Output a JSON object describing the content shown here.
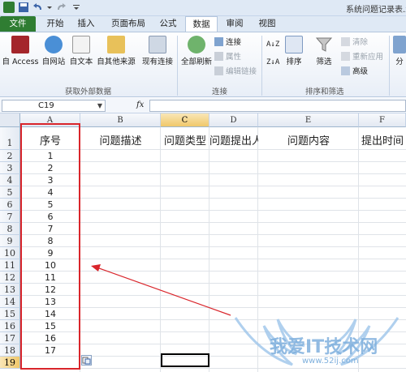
{
  "window": {
    "title": "系统问题记录表.x"
  },
  "ribbon_tabs": [
    "文件",
    "开始",
    "插入",
    "页面布局",
    "公式",
    "数据",
    "审阅",
    "视图"
  ],
  "active_tab": "数据",
  "ribbon": {
    "group_get_external": {
      "label": "获取外部数据",
      "buttons": [
        "自 Access",
        "自网站",
        "自文本",
        "自其他来源",
        "现有连接"
      ]
    },
    "group_connections": {
      "label": "连接",
      "refresh_all": "全部刷新",
      "connections": "连接",
      "properties": "属性",
      "edit_links": "编辑链接"
    },
    "group_sort_filter": {
      "label": "排序和筛选",
      "sort": "排序",
      "filter": "筛选",
      "clear": "清除",
      "reapply": "重新应用",
      "advanced": "高级"
    },
    "group_partial": {
      "button": "分"
    }
  },
  "formula_bar": {
    "name_box": "C19",
    "fx": "fx",
    "formula": ""
  },
  "sheet": {
    "columns": [
      "A",
      "B",
      "C",
      "D",
      "E",
      "F"
    ],
    "selected_column": "C",
    "row_numbers": [
      "1",
      "2",
      "3",
      "4",
      "5",
      "6",
      "7",
      "8",
      "9",
      "10",
      "11",
      "12",
      "13",
      "14",
      "15",
      "16",
      "17",
      "18",
      "19"
    ],
    "selected_row": "19",
    "header_row": [
      "序号",
      "问题描述",
      "问题类型",
      "问题提出人",
      "问题内容",
      "提出时间"
    ],
    "col_a_values": [
      "1",
      "2",
      "3",
      "4",
      "5",
      "6",
      "7",
      "8",
      "9",
      "10",
      "11",
      "12",
      "13",
      "14",
      "15",
      "16",
      "17"
    ]
  },
  "watermark": {
    "text": "我爱IT技术网",
    "url": "www.52ij.com"
  },
  "colors": {
    "file_tab": "#2f7d32",
    "highlight_box": "#d9252b",
    "arrow": "#d9252b",
    "selected_header": "#f0c86a"
  }
}
